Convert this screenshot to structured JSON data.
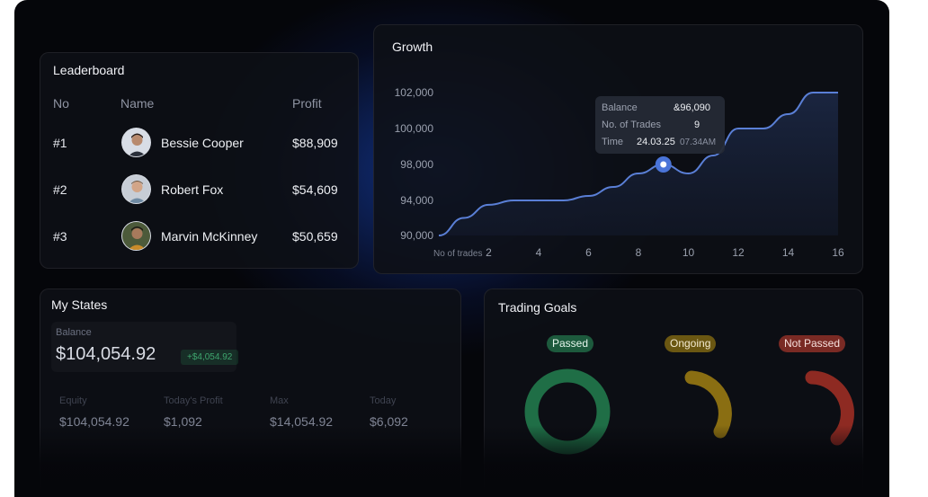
{
  "leaderboard": {
    "title": "Leaderboard",
    "headers": {
      "no": "No",
      "name": "Name",
      "profit": "Profit"
    },
    "rows": [
      {
        "rank": "#1",
        "name": "Bessie Cooper",
        "profit": "$88,909"
      },
      {
        "rank": "#2",
        "name": "Robert Fox",
        "profit": "$54,609"
      },
      {
        "rank": "#3",
        "name": "Marvin McKinney",
        "profit": "$50,659"
      }
    ]
  },
  "growth": {
    "title": "Growth",
    "tooltip": {
      "balance_label": "Balance",
      "balance_value": "&96,090",
      "trades_label": "No. of Trades",
      "trades_value": "9",
      "time_label": "Time",
      "time_date": "24.03.25",
      "time_clock": "07.34AM"
    }
  },
  "chart_data": {
    "type": "area",
    "title": "Growth",
    "xlabel": "No of trades",
    "ylabel": "",
    "y_ticks": [
      "102,000",
      "100,000",
      "98,000",
      "94,000",
      "90,000"
    ],
    "x_ticks": [
      "2",
      "4",
      "6",
      "8",
      "10",
      "12",
      "14",
      "16"
    ],
    "x": [
      0,
      1,
      2,
      3,
      4,
      5,
      6,
      7,
      8,
      9,
      10,
      11,
      12,
      13,
      14,
      15,
      16
    ],
    "y": [
      90000,
      92000,
      93500,
      94000,
      94000,
      94000,
      94500,
      95500,
      97000,
      98000,
      97000,
      98500,
      100000,
      100000,
      100800,
      102000,
      102000
    ],
    "highlight": {
      "x": 9,
      "y": 98000
    },
    "colors": {
      "line": "#5a7fd6",
      "marker": "#4a74d8"
    }
  },
  "my_states": {
    "title": "My States",
    "balance_label": "Balance",
    "balance_value": "$104,054.92",
    "balance_change": "+$4,054.92",
    "stats": [
      {
        "label": "Equity",
        "value": "$104,054.92"
      },
      {
        "label": "Today's Profit",
        "value": "$1,092"
      },
      {
        "label": "Max",
        "value": "$14,054.92"
      },
      {
        "label": "Today",
        "value": "$6,092"
      }
    ]
  },
  "trading_goals": {
    "title": "Trading Goals",
    "statuses": [
      {
        "label": "Passed",
        "color": "#1d5a3d",
        "ring": "#1f6e46"
      },
      {
        "label": "Ongoing",
        "color": "#6b5712",
        "ring": "#8a6e12"
      },
      {
        "label": "Not Passed",
        "color": "#7a2a24",
        "ring": "#8e2a22"
      }
    ]
  }
}
